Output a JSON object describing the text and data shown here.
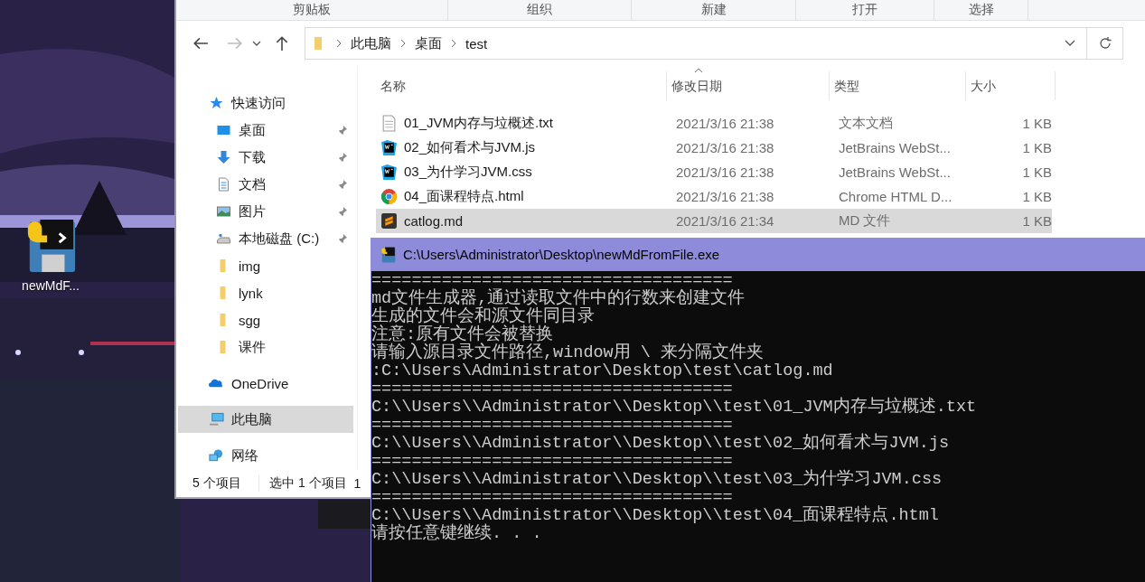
{
  "desktop": {
    "icons": [
      {
        "label": "newMdF..."
      }
    ]
  },
  "explorer": {
    "ribbon_groups": [
      "剪贴板",
      "组织",
      "新建",
      "打开",
      "选择"
    ],
    "nav_buttons": [
      {
        "kind": "back",
        "disabled": false
      },
      {
        "kind": "forward",
        "disabled": true
      },
      {
        "kind": "recent",
        "disabled": false
      },
      {
        "kind": "up",
        "disabled": false
      }
    ],
    "breadcrumb": [
      "此电脑",
      "桌面",
      "test"
    ],
    "nav_pane": [
      {
        "label": "快速访问",
        "kind": "star",
        "pinned": false,
        "selected": false,
        "children": [
          {
            "label": "桌面",
            "kind": "desktop",
            "pinned": true,
            "selected": false
          },
          {
            "label": "下载",
            "kind": "download",
            "pinned": true,
            "selected": false
          },
          {
            "label": "文档",
            "kind": "document",
            "pinned": true,
            "selected": false
          },
          {
            "label": "图片",
            "kind": "pictures",
            "pinned": true,
            "selected": false
          },
          {
            "label": "本地磁盘 (C:)",
            "kind": "drive",
            "pinned": true,
            "selected": false
          },
          {
            "label": "img",
            "kind": "folder",
            "pinned": false,
            "selected": false
          },
          {
            "label": "lynk",
            "kind": "folder",
            "pinned": false,
            "selected": false
          },
          {
            "label": "sgg",
            "kind": "folder",
            "pinned": false,
            "selected": false
          },
          {
            "label": "课件",
            "kind": "folder",
            "pinned": false,
            "selected": false
          }
        ]
      },
      {
        "label": "OneDrive",
        "kind": "cloud",
        "pinned": false,
        "selected": false
      },
      {
        "label": "此电脑",
        "kind": "computer",
        "pinned": false,
        "selected": true
      },
      {
        "label": "网络",
        "kind": "network",
        "pinned": false,
        "selected": false
      }
    ],
    "table": {
      "columns": [
        "名称",
        "修改日期",
        "类型",
        "大小"
      ],
      "rows": [
        {
          "kind": "text",
          "name": "01_JVM内存与垃概述.txt",
          "modified": "2021/3/16 21:38",
          "type": "文本文档",
          "size": "1 KB",
          "selected": false
        },
        {
          "kind": "webstorm",
          "name": "02_如何看术与JVM.js",
          "modified": "2021/3/16 21:38",
          "type": "JetBrains WebSt...",
          "size": "1 KB",
          "selected": false
        },
        {
          "kind": "webstorm",
          "name": "03_为什学习JVM.css",
          "modified": "2021/3/16 21:38",
          "type": "JetBrains WebSt...",
          "size": "1 KB",
          "selected": false
        },
        {
          "kind": "chrome",
          "name": "04_面课程特点.html",
          "modified": "2021/3/16 21:38",
          "type": "Chrome HTML D...",
          "size": "1 KB",
          "selected": false
        },
        {
          "kind": "sublime",
          "name": "catlog.md",
          "modified": "2021/3/16 21:34",
          "type": "MD 文件",
          "size": "1 KB",
          "selected": true
        }
      ]
    },
    "status_bar": [
      "5 个项目",
      "选中 1 个项目",
      "1"
    ]
  },
  "console": {
    "title": "C:\\Users\\Administrator\\Desktop\\newMdFromFile.exe",
    "lines": [
      "====================================",
      "md文件生成器,通过读取文件中的行数来创建文件",
      "生成的文件会和源文件同目录",
      "注意:原有文件会被替换",
      "请输入源目录文件路径,window用 \\ 来分隔文件夹",
      ":C:\\Users\\Administrator\\Desktop\\test\\catlog.md",
      "====================================",
      "C:\\\\Users\\\\Administrator\\\\Desktop\\\\test\\01_JVM内存与垃概述.txt",
      "====================================",
      "C:\\\\Users\\\\Administrator\\\\Desktop\\\\test\\02_如何看术与JVM.js",
      "====================================",
      "C:\\\\Users\\\\Administrator\\\\Desktop\\\\test\\03_为什学习JVM.css",
      "====================================",
      "C:\\\\Users\\\\Administrator\\\\Desktop\\\\test\\04_面课程特点.html",
      "请按任意键继续. . ."
    ]
  }
}
